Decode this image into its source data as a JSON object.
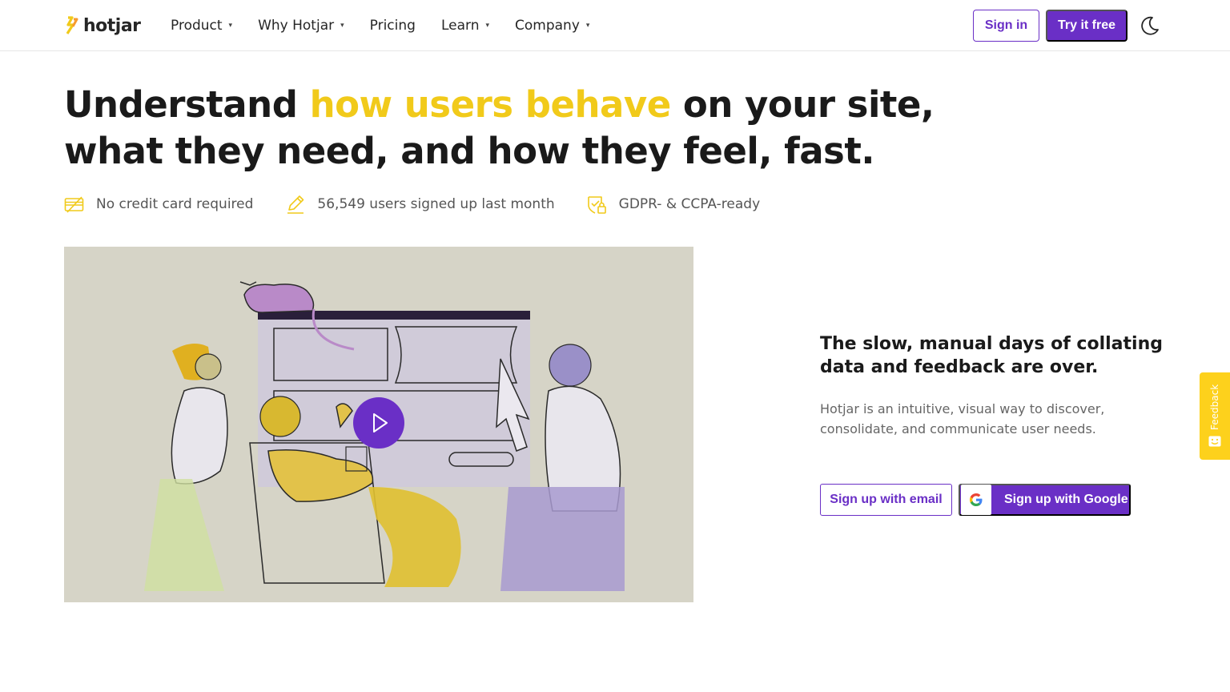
{
  "header": {
    "logo_text": "hotjar",
    "nav": [
      {
        "label": "Product",
        "has_dropdown": true
      },
      {
        "label": "Why Hotjar",
        "has_dropdown": true
      },
      {
        "label": "Pricing",
        "has_dropdown": false
      },
      {
        "label": "Learn",
        "has_dropdown": true
      },
      {
        "label": "Company",
        "has_dropdown": true
      }
    ],
    "sign_in": "Sign in",
    "try_free": "Try it free",
    "theme_icon": "moon-icon"
  },
  "hero": {
    "title_part1": "Understand ",
    "title_highlight": "how users behave",
    "title_part2": " on your site, what they need, and how they feel, fast.",
    "highlight_color": "#f1ca1a"
  },
  "badges": [
    {
      "icon": "credit-card-crossed-icon",
      "text": "No credit card required"
    },
    {
      "icon": "pencil-icon",
      "text": "56,549 users signed up last month"
    },
    {
      "icon": "shield-lock-icon",
      "text": "GDPR- & CCPA-ready"
    }
  ],
  "illustration": {
    "play_icon": "play-icon"
  },
  "right": {
    "subhead": "The slow, manual days of collating data and feedback are over.",
    "description": "Hotjar is an intuitive, visual way to discover, consolidate, and communicate user needs.",
    "btn_email": "Sign up with email",
    "btn_google": "Sign up with Google"
  },
  "feedback": {
    "label": "Feedback"
  },
  "colors": {
    "brand_purple": "#6a2fc6",
    "brand_yellow": "#f1ca1a",
    "feedback_yellow": "#fdd11c"
  }
}
